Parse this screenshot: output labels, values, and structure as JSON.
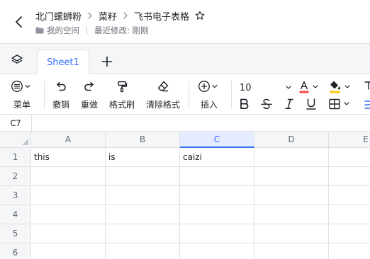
{
  "header": {
    "breadcrumb": [
      "北门螺蛳粉",
      "菜籽",
      "飞书电子表格"
    ],
    "location": "我的空间",
    "last_modified": "最近修改: 刚刚"
  },
  "tabs": {
    "sheets": [
      "Sheet1"
    ]
  },
  "toolbar": {
    "menu": "菜单",
    "undo": "撤销",
    "redo": "重做",
    "format_painter": "格式刷",
    "clear_format": "清除格式",
    "insert": "插入",
    "font_size": "10",
    "colors": {
      "font_color": "#f54a45",
      "fill_color": "#ffc60a",
      "accent": "#3370ff"
    }
  },
  "formula_bar": {
    "cell_ref": "C7",
    "value": ""
  },
  "grid": {
    "columns": [
      "A",
      "B",
      "C",
      "D",
      "E"
    ],
    "active_column": "C",
    "rows": [
      "1",
      "2",
      "3",
      "4",
      "5",
      "6"
    ],
    "cells": [
      [
        "this",
        "is",
        "caizi",
        "",
        ""
      ],
      [
        "",
        "",
        "",
        "",
        ""
      ],
      [
        "",
        "",
        "",
        "",
        ""
      ],
      [
        "",
        "",
        "",
        "",
        ""
      ],
      [
        "",
        "",
        "",
        "",
        ""
      ],
      [
        "",
        "",
        "",
        "",
        ""
      ]
    ]
  }
}
